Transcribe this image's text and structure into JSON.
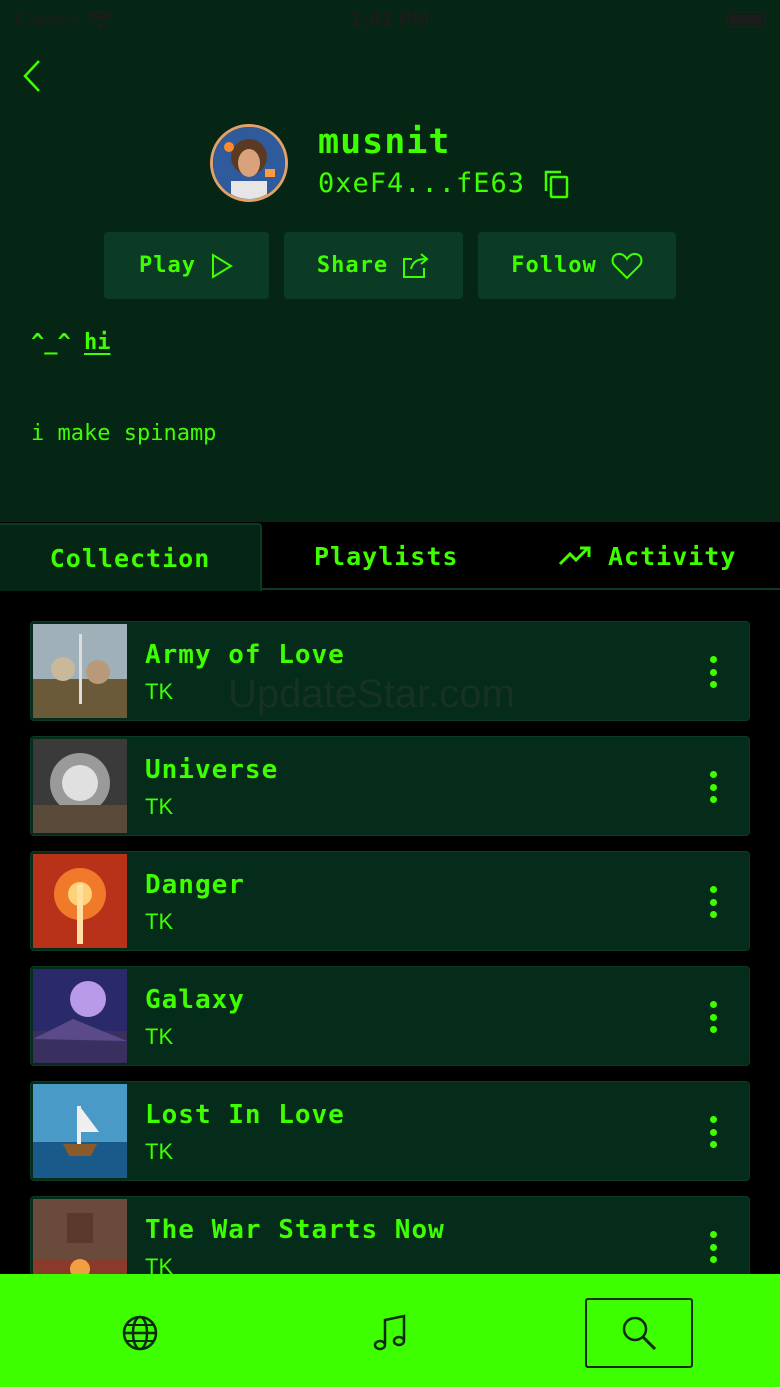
{
  "status_bar": {
    "carrier": "Carrier",
    "time": "1:41 PM"
  },
  "profile": {
    "username": "musnit",
    "address": "0xeF4...fE63",
    "bio_heading_prefix": "^_^",
    "bio_heading_link": "hi",
    "bio_text": "i make spinamp"
  },
  "actions": {
    "play_label": "Play",
    "share_label": "Share",
    "follow_label": "Follow"
  },
  "tabs": {
    "collection": "Collection",
    "playlists": "Playlists",
    "activity": "Activity"
  },
  "tracks": [
    {
      "title": "Army of Love",
      "artist": "TK"
    },
    {
      "title": "Universe",
      "artist": "TK"
    },
    {
      "title": "Danger",
      "artist": "TK"
    },
    {
      "title": "Galaxy",
      "artist": "TK"
    },
    {
      "title": "Lost In Love",
      "artist": "TK"
    },
    {
      "title": "The War Starts Now",
      "artist": "TK"
    }
  ],
  "watermark": "UpdateStar.com",
  "colors": {
    "accent": "#3dff00",
    "background": "#052515",
    "card": "#0b3a25",
    "nav": "#3dff00"
  },
  "bottom_nav": [
    "globe-icon",
    "music-note-icon",
    "search-icon"
  ]
}
